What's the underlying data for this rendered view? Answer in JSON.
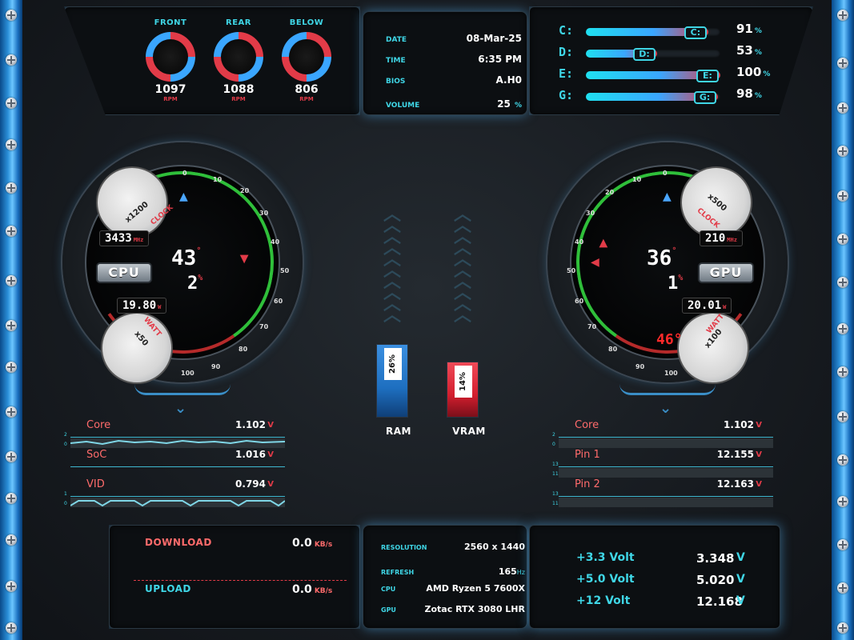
{
  "fans": [
    {
      "label": "FRONT",
      "value": "1097",
      "unit": "RPM"
    },
    {
      "label": "REAR",
      "value": "1088",
      "unit": "RPM"
    },
    {
      "label": "BELOW",
      "value": "806",
      "unit": "RPM"
    }
  ],
  "info": {
    "date_label": "DATE",
    "date": "08-Mar-25",
    "time_label": "TIME",
    "time": "6:35 PM",
    "bios_label": "BIOS",
    "bios": "A.H0",
    "volume_label": "VOLUME",
    "volume": "25",
    "volume_unit": "%"
  },
  "drives": [
    {
      "letter": "C:",
      "percent": 91,
      "percent_text": "91",
      "unit": "%"
    },
    {
      "letter": "D:",
      "percent": 53,
      "percent_text": "53",
      "unit": "%"
    },
    {
      "letter": "E:",
      "percent": 100,
      "percent_text": "100",
      "unit": "%"
    },
    {
      "letter": "G:",
      "percent": 98,
      "percent_text": "98",
      "unit": "%"
    }
  ],
  "cpu_gauge": {
    "chip": "CPU",
    "clock": "3433",
    "clock_unit": "MHz",
    "temp": "43",
    "temp_unit": "°",
    "load": "2",
    "load_unit": "%",
    "power": "19.80",
    "power_unit": "W",
    "clock_tag": "CLOCK",
    "clock_mult": "x1200",
    "watt_tag": "WATT",
    "watt_mult": "x50",
    "ticks": [
      "0",
      "10",
      "20",
      "30",
      "40",
      "50",
      "60",
      "70",
      "80",
      "90",
      "100"
    ]
  },
  "gpu_gauge": {
    "chip": "GPU",
    "clock": "210",
    "clock_unit": "MHz",
    "temp": "36",
    "temp_unit": "°",
    "load": "1",
    "load_unit": "%",
    "power": "20.01",
    "power_unit": "W",
    "hot_temp": "46°",
    "clock_tag": "CLOCK",
    "clock_mult": "x500",
    "watt_tag": "WATT",
    "watt_mult": "x100",
    "ticks": [
      "0",
      "10",
      "20",
      "30",
      "40",
      "50",
      "60",
      "70",
      "80",
      "90",
      "100"
    ]
  },
  "ram": {
    "label": "RAM",
    "percent": 26,
    "tag": "26%",
    "color": "#1e6fc0"
  },
  "vram": {
    "label": "VRAM",
    "percent": 14,
    "tag": "14%",
    "color": "#d21e2e"
  },
  "cpu_volts": [
    {
      "name": "Core",
      "value": "1.102",
      "unit": "V",
      "scale_top": "2",
      "scale_bot": "0"
    },
    {
      "name": "SoC",
      "value": "1.016",
      "unit": "V",
      "scale_top": "",
      "scale_bot": ""
    },
    {
      "name": "VID",
      "value": "0.794",
      "unit": "V",
      "scale_top": "1",
      "scale_bot": "0"
    }
  ],
  "gpu_volts": [
    {
      "name": "Core",
      "value": "1.102",
      "unit": "V",
      "scale_top": "2",
      "scale_bot": "0"
    },
    {
      "name": "Pin 1",
      "value": "12.155",
      "unit": "V",
      "scale_top": "13",
      "scale_bot": "11"
    },
    {
      "name": "Pin 2",
      "value": "12.163",
      "unit": "V",
      "scale_top": "13",
      "scale_bot": "11"
    }
  ],
  "network": {
    "download_label": "DOWNLOAD",
    "download": "0.0",
    "download_unit": "KB/s",
    "upload_label": "UPLOAD",
    "upload": "0.0",
    "upload_unit": "KB/s"
  },
  "system": {
    "resolution_label": "RESOLUTION",
    "resolution": "2560 x 1440",
    "refresh_label": "REFRESH",
    "refresh": "165",
    "refresh_unit": "Hz",
    "cpu_label": "CPU",
    "cpu": "AMD Ryzen 5 7600X",
    "gpu_label": "GPU",
    "gpu": "Zotac RTX 3080 LHR"
  },
  "rails": [
    {
      "name": "+3.3 Volt",
      "value": "3.348",
      "unit": "V"
    },
    {
      "name": "+5.0 Volt",
      "value": "5.020",
      "unit": "V"
    },
    {
      "name": "+12  Volt",
      "value": "12.168",
      "unit": "V"
    }
  ],
  "colors": {
    "accent": "#3fd6e6",
    "alert": "#e23b48",
    "ram": "#1e6fc0",
    "vram": "#d21e2e"
  }
}
